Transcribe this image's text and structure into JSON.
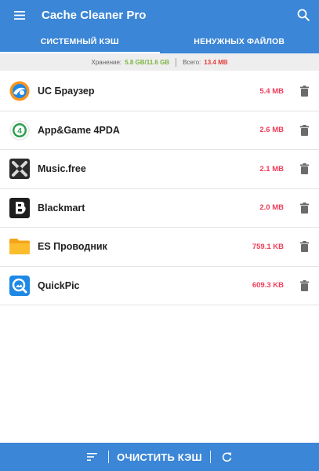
{
  "app": {
    "title": "Cache Cleaner Pro"
  },
  "tabs": [
    {
      "label": "СИСТЕМНЫЙ КЭШ",
      "active": true
    },
    {
      "label": "НЕНУЖНЫХ ФАЙЛОВ",
      "active": false
    }
  ],
  "storage": {
    "storage_label": "Хранение:",
    "storage_value": "5.8 GB/11.6 GB",
    "total_label": "Всего:",
    "total_value": "13.4 MB"
  },
  "apps": [
    {
      "name": "UC Браузер",
      "size": "5.4 MB",
      "icon": "uc-browser-icon"
    },
    {
      "name": "App&Game 4PDA",
      "size": "2.6 MB",
      "icon": "4pda-icon"
    },
    {
      "name": "Music.free",
      "size": "2.1 MB",
      "icon": "music-free-icon"
    },
    {
      "name": "Blackmart",
      "size": "2.0 MB",
      "icon": "blackmart-icon"
    },
    {
      "name": "ES Проводник",
      "size": "759.1 KB",
      "icon": "es-explorer-icon"
    },
    {
      "name": "QuickPic",
      "size": "609.3 KB",
      "icon": "quickpic-icon"
    }
  ],
  "bottom": {
    "clean_label": "ОЧИСТИТЬ КЭШ"
  },
  "colors": {
    "primary": "#3b86d6",
    "size_red": "#ef3d5a",
    "storage_green": "#7cb342",
    "total_red": "#e53935"
  }
}
